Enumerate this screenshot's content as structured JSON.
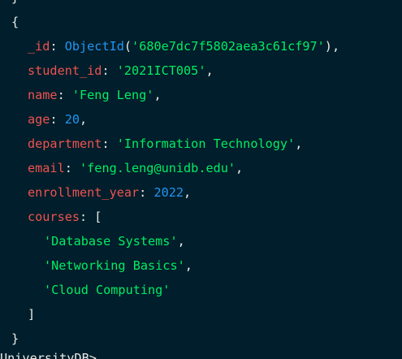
{
  "output": {
    "prev_close": "}",
    "open_brace": "{",
    "close_brace": "}",
    "fields": {
      "id": {
        "key": "_id",
        "constructor": "ObjectId",
        "value": "'680e7dc7f5802aea3c61cf97'"
      },
      "student_id": {
        "key": "student_id",
        "value": "'2021ICT005'"
      },
      "name": {
        "key": "name",
        "value": "'Feng Leng'"
      },
      "age": {
        "key": "age",
        "value": "20"
      },
      "department": {
        "key": "department",
        "value": "'Information Technology'"
      },
      "email": {
        "key": "email",
        "value": "'feng.leng@unidb.edu'"
      },
      "enrollment_year": {
        "key": "enrollment_year",
        "value": "2022"
      },
      "courses": {
        "key": "courses",
        "items": [
          "'Database Systems'",
          "'Networking Basics'",
          "'Cloud Computing'"
        ]
      }
    },
    "prompt": "UniversityDB>"
  },
  "colors": {
    "background": "#001e2b",
    "key": "#ef5350",
    "string": "#00ed64",
    "number": "#2196f3",
    "text": "#e8edeb"
  }
}
